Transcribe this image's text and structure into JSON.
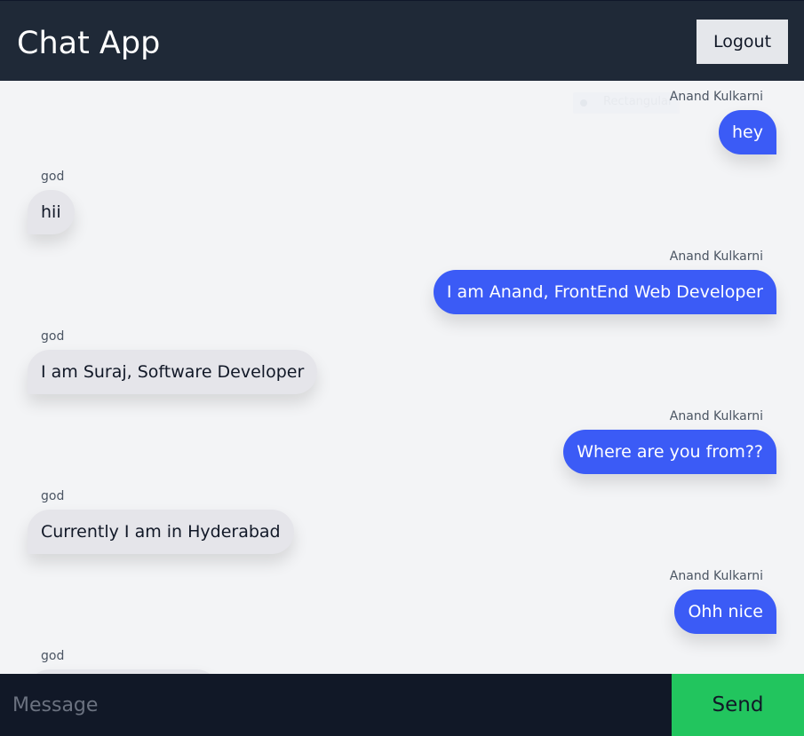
{
  "header": {
    "title": "Chat App",
    "logout_label": "Logout"
  },
  "ghost_tooltip": {
    "label": "Rectangular"
  },
  "messages": [
    {
      "sender": "Anand Kulkarni",
      "text": "hey",
      "direction": "outgoing"
    },
    {
      "sender": "god",
      "text": "hii",
      "direction": "incoming"
    },
    {
      "sender": "Anand Kulkarni",
      "text": "I am Anand, FrontEnd Web Developer",
      "direction": "outgoing"
    },
    {
      "sender": "god",
      "text": "I am Suraj, Software Developer",
      "direction": "incoming"
    },
    {
      "sender": "Anand Kulkarni",
      "text": "Where are you from??",
      "direction": "outgoing"
    },
    {
      "sender": "god",
      "text": "Currently I am in Hyderabad",
      "direction": "incoming"
    },
    {
      "sender": "Anand Kulkarni",
      "text": "Ohh nice",
      "direction": "outgoing"
    },
    {
      "sender": "god",
      "text": "",
      "direction": "incoming"
    }
  ],
  "composer": {
    "placeholder": "Message",
    "value": "",
    "send_label": "Send"
  },
  "colors": {
    "header_bg": "#1f2937",
    "outgoing_bubble": "#3b5bf6",
    "incoming_bubble": "#e5e5ea",
    "send_button": "#22c55e",
    "composer_bg": "#111827"
  }
}
